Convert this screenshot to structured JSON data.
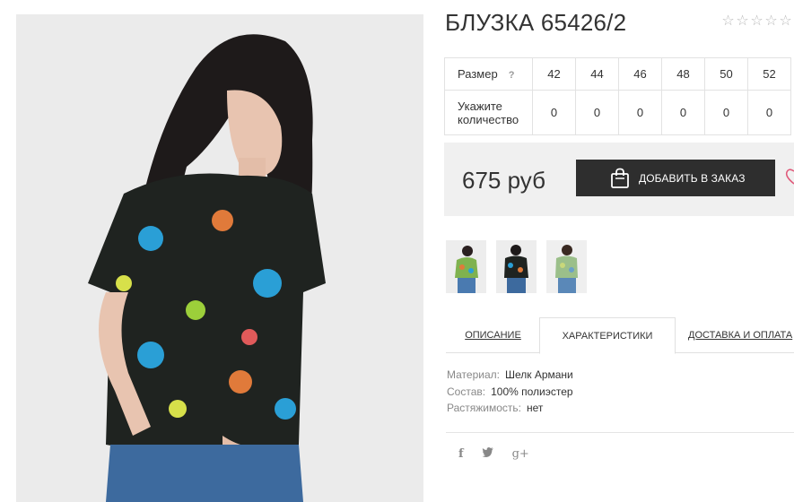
{
  "product": {
    "title": "БЛУЗКА 65426/2",
    "rating_stars": [
      "☆",
      "☆",
      "☆",
      "☆",
      "☆"
    ],
    "main_photo_icon": "woman-in-floral-blouse-photo"
  },
  "size_table": {
    "size_label": "Размер",
    "help_mark": "?",
    "sizes": [
      "42",
      "44",
      "46",
      "48",
      "50",
      "52"
    ],
    "quantity_label": "Укажите количество",
    "quantities": [
      "0",
      "0",
      "0",
      "0",
      "0",
      "0"
    ]
  },
  "purchase": {
    "price": "675 руб",
    "add_button_label": "ДОБАВИТЬ В ЗАКАЗ",
    "bag_icon": "shopping-bag-icon",
    "wishlist_icon": "heart-icon"
  },
  "tabs": [
    {
      "label": "ОПИСАНИЕ"
    },
    {
      "label": "ХАРАКТЕРИСТИКИ"
    },
    {
      "label": "ДОСТАВКА И ОПЛАТА"
    }
  ],
  "characteristics": [
    {
      "key": "Материал:",
      "value": "Шелк Армани"
    },
    {
      "key": "Состав:",
      "value": "100% полиэстер"
    },
    {
      "key": "Растяжимость:",
      "value": "нет"
    }
  ],
  "social": [
    "f",
    "🐦",
    "g+"
  ],
  "colors": {
    "button_bg": "#2e2e2e",
    "price_block_bg": "#f0f0f0",
    "heart_pink": "#e05a7a"
  }
}
